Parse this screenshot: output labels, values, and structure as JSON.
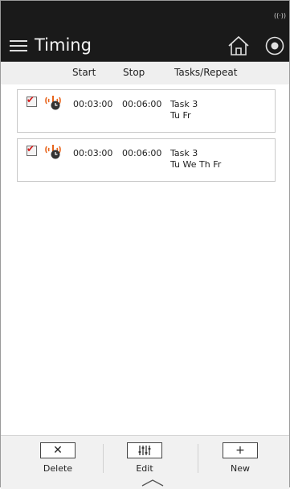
{
  "status": {
    "icon": "signal-icon"
  },
  "app": {
    "title": "Timing"
  },
  "header_icons": [
    "menu-icon",
    "home-icon",
    "stop-circle-icon"
  ],
  "columns": {
    "start": "Start",
    "stop": "Stop",
    "tasks": "Tasks/Repeat"
  },
  "rows": [
    {
      "checked": true,
      "start": "00:03:00",
      "stop": "00:06:00",
      "task": "Task 3",
      "repeat": "Tu Fr"
    },
    {
      "checked": true,
      "start": "00:03:00",
      "stop": "00:06:00",
      "task": "Task 3",
      "repeat": "Tu We Th Fr"
    }
  ],
  "toolbar": {
    "delete_label": "Delete",
    "edit_label": "Edit",
    "new_label": "New"
  },
  "colors": {
    "header_bg": "#1a1a1a",
    "alarm": "#e8641b",
    "check": "#d62020"
  }
}
